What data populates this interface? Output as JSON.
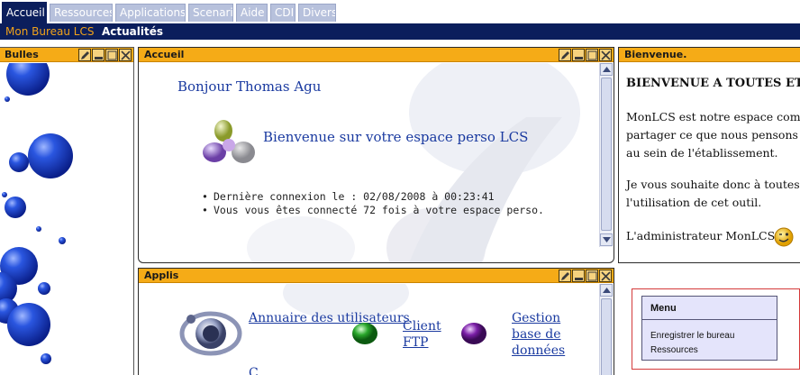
{
  "tabs": [
    {
      "label": "Accueil",
      "active": true
    },
    {
      "label": "Ressources",
      "active": false
    },
    {
      "label": "Applications",
      "active": false
    },
    {
      "label": "Scenari",
      "active": false
    },
    {
      "label": "Aide",
      "active": false
    },
    {
      "label": "CDI",
      "active": false
    },
    {
      "label": "Divers",
      "active": false
    }
  ],
  "subtabs": [
    {
      "label": "Mon Bureau LCS",
      "color": "#f0a21a"
    },
    {
      "label": "Actualités",
      "color": "#ffffff"
    }
  ],
  "panels": {
    "bulles": {
      "title": "Bulles"
    },
    "accueil": {
      "title": "Accueil",
      "greeting": "Bonjour Thomas Agu",
      "welcome": "Bienvenue sur votre espace perso LCS",
      "info": [
        "Dernière connexion le : 02/08/2008 à 00:23:41",
        "Vous vous êtes connecté 72 fois à votre espace perso."
      ]
    },
    "applis": {
      "title": "Applis",
      "apps": [
        {
          "label": "Annuaire des utilisateurs",
          "icon": "annuaire-icon"
        },
        {
          "label": "Client FTP",
          "icon": "ftp-icon"
        },
        {
          "label": "Gestion base de données",
          "icon": "database-icon"
        }
      ],
      "more_label": "C"
    },
    "bienvenue": {
      "title": "Bienvenue.",
      "heading": "BIENVENUE A TOUTES ET",
      "paragraphs": [
        [
          "MonLCS est notre espace comm",
          "partager ce que nous pensons êt",
          "au sein de l'établissement."
        ],
        [
          "Je vous souhaite donc à toutes e",
          "l'utilisation de cet outil."
        ]
      ],
      "signature": "L'administrateur MonLCS."
    }
  },
  "menu": {
    "title": "Menu",
    "items": [
      "Enregistrer le bureau",
      "Ressources"
    ]
  },
  "colors": {
    "nav_dark": "#0b1e5c",
    "panel_header": "#f5ab17",
    "tab_inactive": "#b7c1dc",
    "link": "#1a3aa0"
  }
}
